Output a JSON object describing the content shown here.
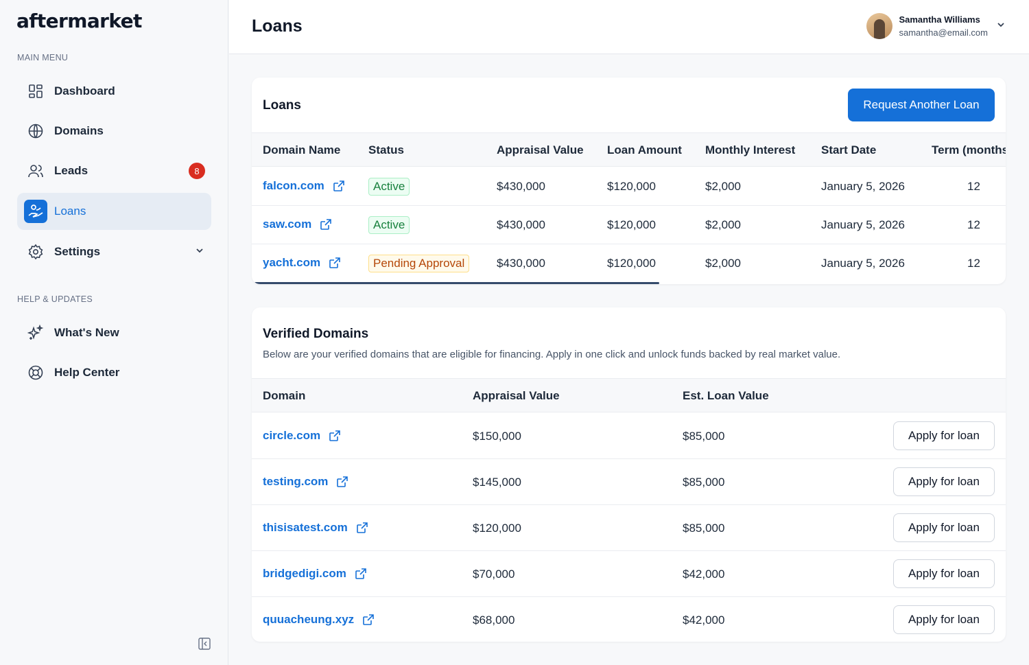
{
  "app": {
    "logo": "aftermarket"
  },
  "sidebar": {
    "main_menu_label": "MAIN MENU",
    "help_label": "HELP & UPDATES",
    "items": [
      {
        "label": "Dashboard",
        "icon": "dashboard-icon"
      },
      {
        "label": "Domains",
        "icon": "globe-icon"
      },
      {
        "label": "Leads",
        "icon": "users-icon",
        "badge": "8"
      },
      {
        "label": "Loans",
        "icon": "loans-icon",
        "active": true
      },
      {
        "label": "Settings",
        "icon": "gear-icon"
      }
    ],
    "help_items": [
      {
        "label": "What's New",
        "icon": "sparkles-icon"
      },
      {
        "label": "Help Center",
        "icon": "lifebuoy-icon"
      }
    ]
  },
  "header": {
    "title": "Loans",
    "user": {
      "name": "Samantha Williams",
      "email": "samantha@email.com"
    }
  },
  "loans": {
    "title": "Loans",
    "request_button": "Request Another Loan",
    "columns": [
      "Domain Name",
      "Status",
      "Appraisal Value",
      "Loan Amount",
      "Monthly Interest",
      "Start Date",
      "Term (months"
    ],
    "rows": [
      {
        "domain": "falcon.com",
        "status": "Active",
        "appraisal": "$430,000",
        "loan": "$120,000",
        "interest": "$2,000",
        "start": "January 5, 2026",
        "term": "12"
      },
      {
        "domain": "saw.com",
        "status": "Active",
        "appraisal": "$430,000",
        "loan": "$120,000",
        "interest": "$2,000",
        "start": "January 5, 2026",
        "term": "12"
      },
      {
        "domain": "yacht.com",
        "status": "Pending Approval",
        "appraisal": "$430,000",
        "loan": "$120,000",
        "interest": "$2,000",
        "start": "January 5, 2026",
        "term": "12"
      }
    ]
  },
  "verified": {
    "title": "Verified Domains",
    "subtitle": "Below are your verified domains that are eligible for financing. Apply in one click and unlock funds backed by real market value.",
    "columns": [
      "Domain",
      "Appraisal Value",
      "Est. Loan Value"
    ],
    "apply_label": "Apply for loan",
    "rows": [
      {
        "domain": "circle.com",
        "appraisal": "$150,000",
        "est": "$85,000"
      },
      {
        "domain": "testing.com",
        "appraisal": "$145,000",
        "est": "$85,000"
      },
      {
        "domain": "thisisatest.com",
        "appraisal": "$120,000",
        "est": "$85,000"
      },
      {
        "domain": "bridgedigi.com",
        "appraisal": "$70,000",
        "est": "$42,000"
      },
      {
        "domain": "quuacheung.xyz",
        "appraisal": "$68,000",
        "est": "$42,000"
      }
    ]
  },
  "colors": {
    "accent": "#1570d8",
    "active_bg": "#e6ecf4",
    "badge": "#d92d20",
    "status_active": "#17803d",
    "status_pending": "#b54708"
  }
}
